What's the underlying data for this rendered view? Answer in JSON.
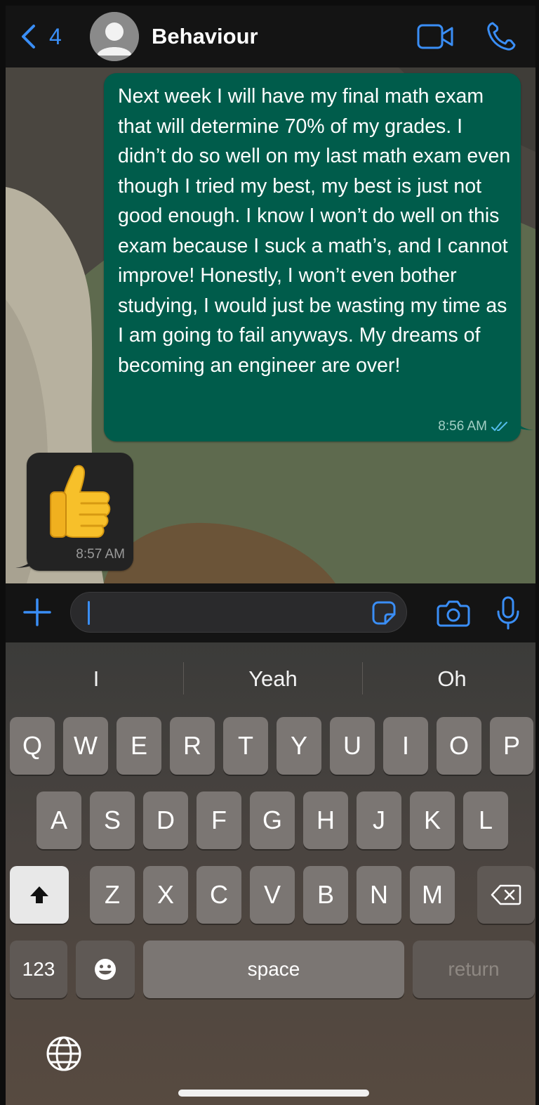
{
  "header": {
    "back_count": "4",
    "contact_name": "Behaviour",
    "icons": [
      "chevron-left-icon",
      "avatar-placeholder",
      "video-camera-icon",
      "phone-icon"
    ]
  },
  "chat": {
    "outgoing": {
      "text": "Next week I will have my final math exam that will determine 70% of my grades. I didn’t do so well on my last math exam even though I tried my best, my best is just not good enough. I know I won’t do well on this exam because I suck a math’s, and I cannot improve! Honestly, I won’t even bother studying, I would just be wasting my time as I am going to fail anyways. My dreams of becoming an engineer are over!",
      "time": "8:56 AM",
      "status_icon": "double-check-icon"
    },
    "incoming": {
      "emoji": "thumbs-up",
      "time": "8:57 AM"
    }
  },
  "input": {
    "value": "",
    "icons": [
      "plus-icon",
      "sticker-icon",
      "camera-icon",
      "microphone-icon"
    ]
  },
  "keyboard": {
    "suggestions": [
      "I",
      "Yeah",
      "Oh"
    ],
    "row1": [
      "Q",
      "W",
      "E",
      "R",
      "T",
      "Y",
      "U",
      "I",
      "O",
      "P"
    ],
    "row2": [
      "A",
      "S",
      "D",
      "F",
      "G",
      "H",
      "J",
      "K",
      "L"
    ],
    "row3": [
      "Z",
      "X",
      "C",
      "V",
      "B",
      "N",
      "M"
    ],
    "numbers_label": "123",
    "space_label": "space",
    "return_label": "return"
  },
  "colors": {
    "accent": "#3a8ef6",
    "outgoing_bubble": "#005c4b",
    "incoming_bubble": "#232323",
    "header_bg": "#141414"
  }
}
